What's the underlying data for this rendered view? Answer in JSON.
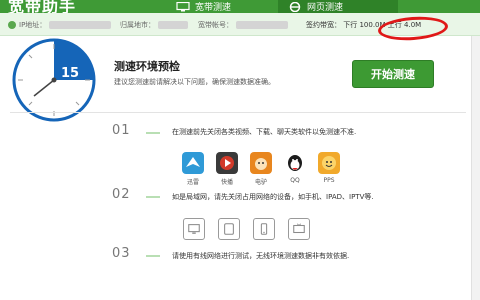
{
  "window": {
    "title": "宽带助手"
  },
  "tabs": [
    {
      "label": "宽带测速"
    },
    {
      "label": "网页测速"
    }
  ],
  "info_bar": {
    "ip_label": "IP地址：",
    "location_label": "归属地市：",
    "account_label": "宽带帐号：",
    "speed_label": "签约带宽：",
    "down_label": "下行",
    "down_value": "100.0M",
    "up_label": "上行",
    "up_value": "4.0M"
  },
  "header": {
    "clock_value": "15",
    "title": "测速环境预检",
    "subtitle": "建议您测速前请解决以下问题，确保测速数据准确。",
    "start_button": "开始测速"
  },
  "steps": [
    {
      "number": "01",
      "text": "在测速前先关闭各类视频、下载、聊天类软件以免测速不准."
    },
    {
      "number": "02",
      "text": "如是局域网，请先关闭占用网络的设备，如手机、IPAD、IPTV等."
    },
    {
      "number": "03",
      "text": "请使用有线网络进行测试，无线环境测速数据非有效依据."
    }
  ],
  "apps": [
    {
      "label": "迅雷",
      "icon": "xunlei-icon",
      "color": "#2f9ad7"
    },
    {
      "label": "快播",
      "icon": "kuaibo-icon",
      "color": "#3a3a3a"
    },
    {
      "label": "电驴",
      "icon": "donkey-icon",
      "color": "#e8861e"
    },
    {
      "label": "QQ",
      "icon": "qq-penguin-icon",
      "color": "#1c1c1c"
    },
    {
      "label": "PPS",
      "icon": "pps-icon",
      "color": "#f1a92b"
    }
  ],
  "devices": [
    {
      "icon": "monitor-icon"
    },
    {
      "icon": "tablet-icon"
    },
    {
      "icon": "phone-icon"
    },
    {
      "icon": "iptv-icon"
    }
  ],
  "colors": {
    "brand_green": "#3d9a33",
    "clock_blue": "#1565b8",
    "highlight_red": "#e01818"
  }
}
